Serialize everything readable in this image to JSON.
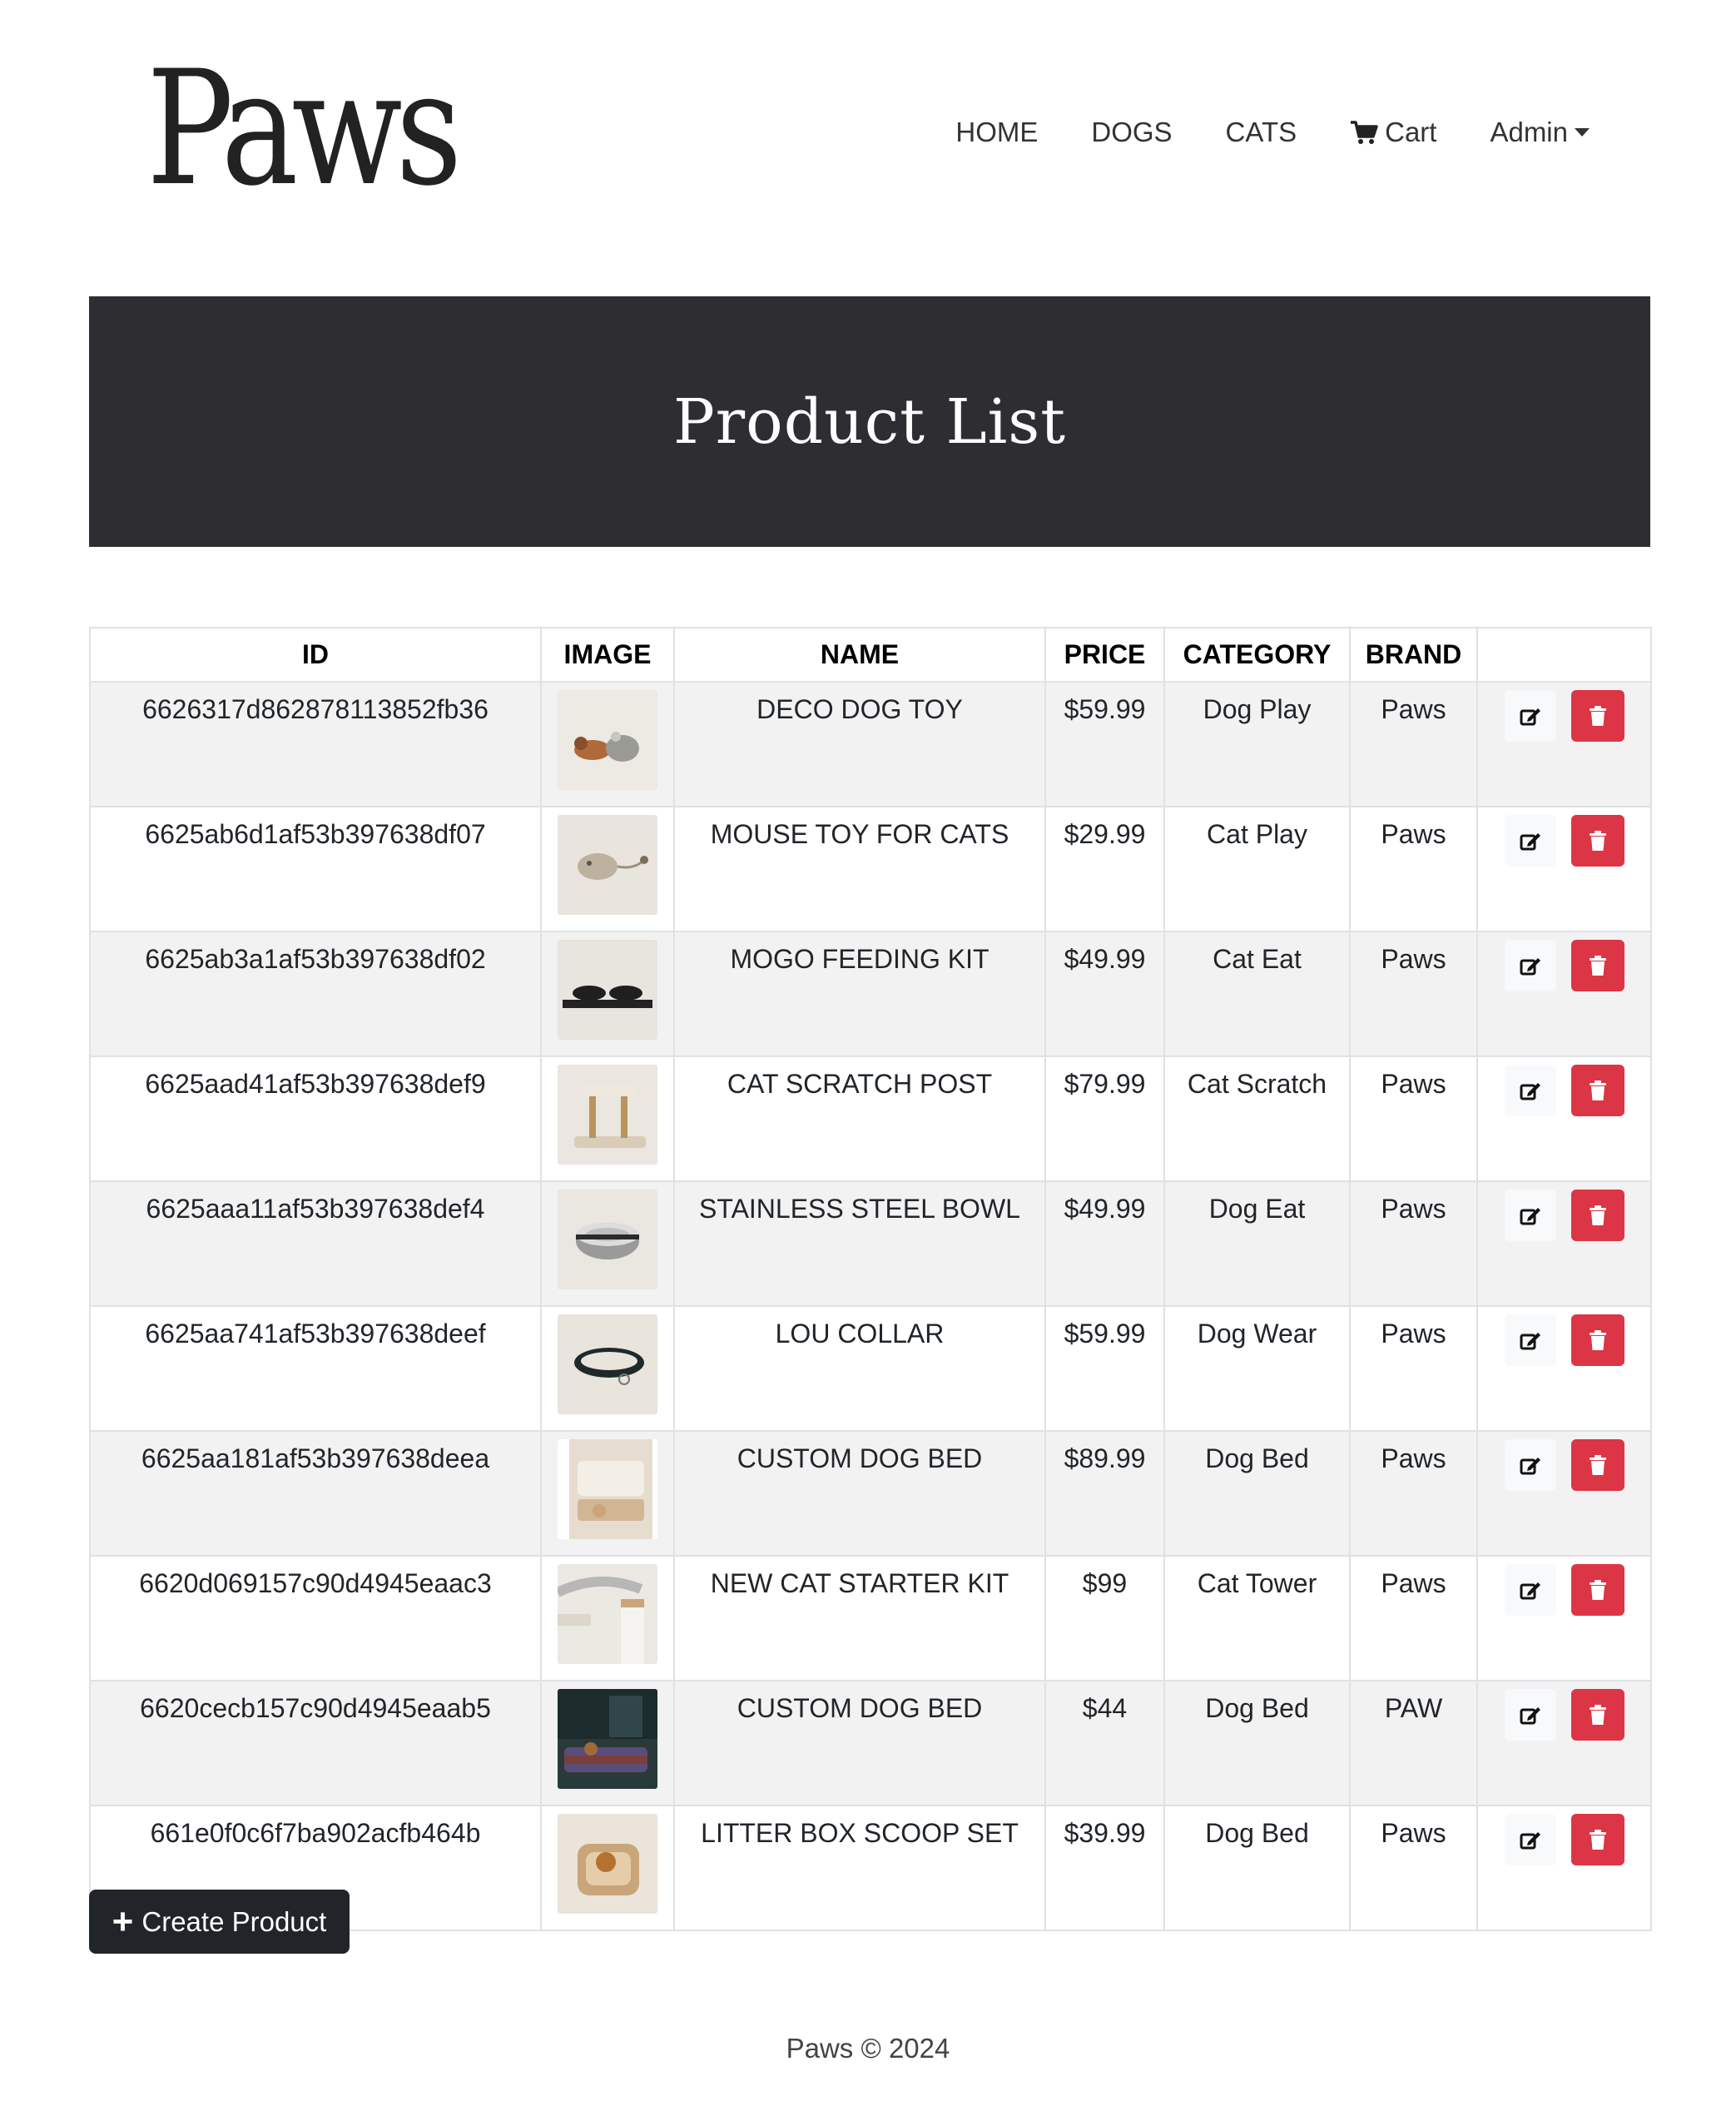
{
  "brand": {
    "logo_text": "Paws"
  },
  "nav": {
    "items": [
      {
        "label": "HOME"
      },
      {
        "label": "DOGS"
      },
      {
        "label": "CATS"
      }
    ],
    "cart": {
      "label": "Cart",
      "icon": "cart-icon"
    },
    "admin": {
      "label": "Admin",
      "icon": "caret-down-icon"
    }
  },
  "banner": {
    "title": "Product List"
  },
  "table": {
    "headers": [
      "ID",
      "IMAGE",
      "NAME",
      "PRICE",
      "CATEGORY",
      "BRAND",
      ""
    ],
    "rows": [
      {
        "id": "6626317d862878113852fb36",
        "name": "DECO DOG TOY",
        "price": "$59.99",
        "category": "Dog Play",
        "brand": "Paws"
      },
      {
        "id": "6625ab6d1af53b397638df07",
        "name": "MOUSE TOY FOR CATS",
        "price": "$29.99",
        "category": "Cat Play",
        "brand": "Paws"
      },
      {
        "id": "6625ab3a1af53b397638df02",
        "name": "MOGO FEEDING KIT",
        "price": "$49.99",
        "category": "Cat Eat",
        "brand": "Paws"
      },
      {
        "id": "6625aad41af53b397638def9",
        "name": "CAT SCRATCH POST",
        "price": "$79.99",
        "category": "Cat Scratch",
        "brand": "Paws"
      },
      {
        "id": "6625aaa11af53b397638def4",
        "name": "STAINLESS STEEL BOWL",
        "price": "$49.99",
        "category": "Dog Eat",
        "brand": "Paws"
      },
      {
        "id": "6625aa741af53b397638deef",
        "name": "LOU COLLAR",
        "price": "$59.99",
        "category": "Dog Wear",
        "brand": "Paws"
      },
      {
        "id": "6625aa181af53b397638deea",
        "name": "CUSTOM DOG BED",
        "price": "$89.99",
        "category": "Dog Bed",
        "brand": "Paws"
      },
      {
        "id": "6620d069157c90d4945eaac3",
        "name": "NEW CAT STARTER KIT",
        "price": "$99",
        "category": "Cat Tower",
        "brand": "Paws"
      },
      {
        "id": "6620cecb157c90d4945eaab5",
        "name": "CUSTOM DOG BED",
        "price": "$44",
        "category": "Dog Bed",
        "brand": "PAW"
      },
      {
        "id": "661e0f0c6f7ba902acfb464b",
        "name": "LITTER BOX SCOOP SET",
        "price": "$39.99",
        "category": "Dog Bed",
        "brand": "Paws"
      }
    ],
    "row_icons": {
      "edit": "edit-icon",
      "delete": "trash-icon"
    }
  },
  "create_button": {
    "label": "Create Product",
    "icon": "plus-icon"
  },
  "footer": {
    "text": "Paws © 2024"
  },
  "colors": {
    "banner_bg": "#2e2d32",
    "delete_red": "#dc3545",
    "create_btn_bg": "#212529",
    "striped_row": "#f2f2f2"
  }
}
